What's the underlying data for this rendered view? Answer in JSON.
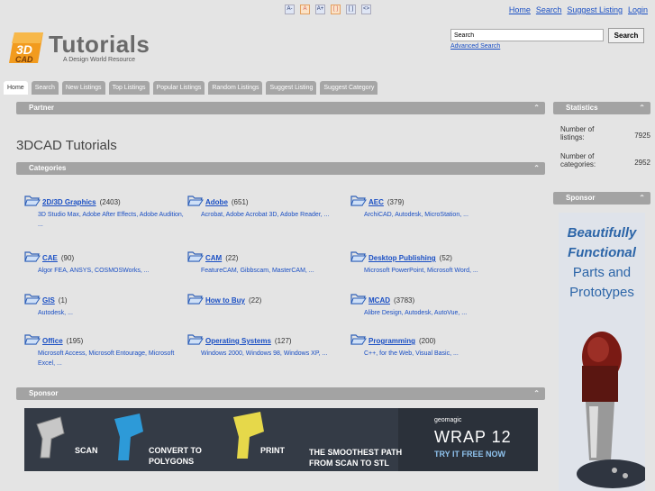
{
  "topbar": {
    "font_controls": [
      "A-",
      "A",
      "A+",
      "[ ]",
      "[ ]",
      "<>"
    ],
    "links": [
      "Home",
      "Search",
      "Suggest Listing",
      "Login"
    ]
  },
  "header": {
    "title": "Tutorials",
    "tagline": "A Design World Resource",
    "search_placeholder": "Search",
    "search_button": "Search",
    "advanced_link": "Advanced Search"
  },
  "tabs": [
    "Home",
    "Search",
    "New Listings",
    "Top Listings",
    "Popular Listings",
    "Random Listings",
    "Suggest Listing",
    "Suggest Category"
  ],
  "main": {
    "partner_bar": "Partner",
    "page_title": "3DCAD Tutorials",
    "categories_bar": "Categories",
    "sponsor_bar": "Sponsor",
    "categories": [
      {
        "name": "2D/3D Graphics",
        "count": "(2403)",
        "sub": "3D Studio Max, Adobe After Effects, Adobe Audition, ..."
      },
      {
        "name": "Adobe",
        "count": "(651)",
        "sub": "Acrobat, Adobe Acrobat 3D, Adobe Reader, ..."
      },
      {
        "name": "AEC",
        "count": "(379)",
        "sub": "ArchiCAD, Autodesk, MicroStation, ..."
      },
      {
        "name": "CAE",
        "count": "(90)",
        "sub": "Algor FEA, ANSYS, COSMOSWorks, ..."
      },
      {
        "name": "CAM",
        "count": "(22)",
        "sub": "FeatureCAM, Gibbscam, MasterCAM, ..."
      },
      {
        "name": "Desktop Publishing",
        "count": "(52)",
        "sub": "Microsoft PowerPoint, Microsoft Word, ..."
      },
      {
        "name": "GIS",
        "count": "(1)",
        "sub": "Autodesk, ..."
      },
      {
        "name": "How to Buy",
        "count": "(22)",
        "sub": ""
      },
      {
        "name": "MCAD",
        "count": "(3783)",
        "sub": "Alibre Design, Autodesk, AutoVue, ..."
      },
      {
        "name": "Office",
        "count": "(195)",
        "sub": "Microsoft Access, Microsoft Entourage, Microsoft Excel, ..."
      },
      {
        "name": "Operating Systems",
        "count": "(127)",
        "sub": "Windows 2000, Windows 98, Windows XP, ..."
      },
      {
        "name": "Programming",
        "count": "(200)",
        "sub": "C++, for the Web, Visual Basic, ..."
      }
    ],
    "banner": {
      "scan": "SCAN",
      "convert1": "CONVERT TO",
      "convert2": "POLYGONS",
      "print": "PRINT",
      "path1": "THE SMOOTHEST PATH",
      "path2": "FROM SCAN TO STL",
      "brand": "geomagic",
      "product": "WRAP 12",
      "cta": "TRY IT FREE NOW"
    }
  },
  "sidebar": {
    "stats_bar": "Statistics",
    "listings_label1": "Number of",
    "listings_label2": "listings:",
    "listings_value": "7925",
    "categories_label1": "Number of",
    "categories_label2": "categories:",
    "categories_value": "2952",
    "sponsor_bar": "Sponsor",
    "ad_line1": "Beautifully",
    "ad_line2": "Functional",
    "ad_line3": "Parts and",
    "ad_line4": "Prototypes"
  },
  "colors": {
    "bar": "#a3a3a3",
    "link": "#1a4fc4",
    "ad_blue": "#2c65a8"
  }
}
